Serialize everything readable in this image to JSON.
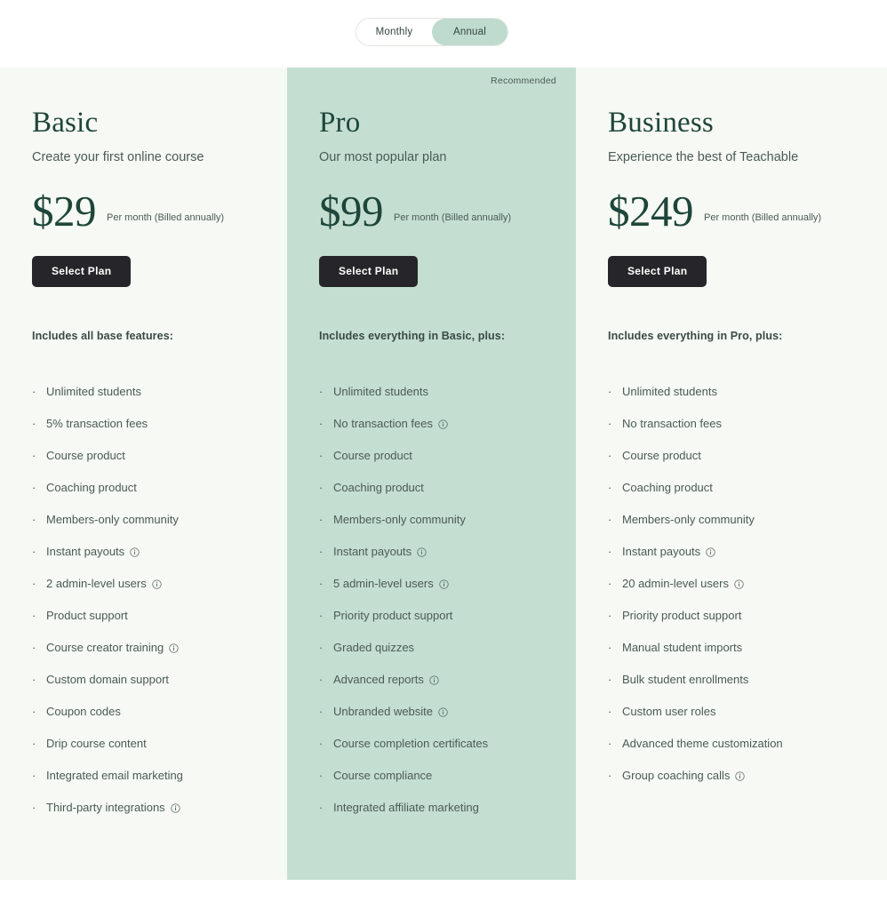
{
  "billing_toggle": {
    "name": "billing-period-toggle",
    "options": [
      {
        "label": "Monthly",
        "selected": false
      },
      {
        "label": "Annual",
        "selected": true
      }
    ]
  },
  "colors": {
    "page_background": "#ffffff",
    "card_background": "#f7f9f4",
    "highlight_background": "#c4dfd2",
    "heading_green": "#1e463a",
    "body_text": "#4a5b54",
    "button_background": "#26262a",
    "button_text": "#ffffff"
  },
  "plans": [
    {
      "name": "Basic",
      "tagline": "Create your first online course",
      "price": "$29",
      "price_note": "Per month (Billed annually)",
      "cta_label": "Select Plan",
      "recommended_label": "",
      "is_recommended": false,
      "features_title": "Includes all base features:",
      "features": [
        {
          "label": "Unlimited students",
          "info": false
        },
        {
          "label": "5% transaction fees",
          "info": false
        },
        {
          "label": "Course product",
          "info": false
        },
        {
          "label": "Coaching product",
          "info": false
        },
        {
          "label": "Members-only community",
          "info": false
        },
        {
          "label": "Instant payouts",
          "info": true
        },
        {
          "label": "2 admin-level users",
          "info": true
        },
        {
          "label": "Product support",
          "info": false
        },
        {
          "label": "Course creator training",
          "info": true
        },
        {
          "label": "Custom domain support",
          "info": false
        },
        {
          "label": "Coupon codes",
          "info": false
        },
        {
          "label": "Drip course content",
          "info": false
        },
        {
          "label": "Integrated email marketing",
          "info": false
        },
        {
          "label": "Third-party integrations",
          "info": true
        }
      ]
    },
    {
      "name": "Pro",
      "tagline": "Our most popular plan",
      "price": "$99",
      "price_note": "Per month (Billed annually)",
      "cta_label": "Select Plan",
      "recommended_label": "Recommended",
      "is_recommended": true,
      "features_title": "Includes everything in Basic, plus:",
      "features": [
        {
          "label": "Unlimited students",
          "info": false
        },
        {
          "label": "No transaction fees",
          "info": true
        },
        {
          "label": "Course product",
          "info": false
        },
        {
          "label": "Coaching product",
          "info": false
        },
        {
          "label": "Members-only community",
          "info": false
        },
        {
          "label": "Instant payouts",
          "info": true
        },
        {
          "label": "5 admin-level users",
          "info": true
        },
        {
          "label": "Priority product support",
          "info": false
        },
        {
          "label": "Graded quizzes",
          "info": false
        },
        {
          "label": "Advanced reports",
          "info": true
        },
        {
          "label": "Unbranded website",
          "info": true
        },
        {
          "label": "Course completion certificates",
          "info": false
        },
        {
          "label": "Course compliance",
          "info": false
        },
        {
          "label": "Integrated affiliate marketing",
          "info": false
        }
      ]
    },
    {
      "name": "Business",
      "tagline": "Experience the best of Teachable",
      "price": "$249",
      "price_note": "Per month (Billed annually)",
      "cta_label": "Select Plan",
      "recommended_label": "",
      "is_recommended": false,
      "features_title": "Includes everything in Pro, plus:",
      "features": [
        {
          "label": "Unlimited students",
          "info": false
        },
        {
          "label": "No transaction fees",
          "info": false
        },
        {
          "label": "Course product",
          "info": false
        },
        {
          "label": "Coaching product",
          "info": false
        },
        {
          "label": "Members-only community",
          "info": false
        },
        {
          "label": "Instant payouts",
          "info": true
        },
        {
          "label": "20 admin-level users",
          "info": true
        },
        {
          "label": "Priority product support",
          "info": false
        },
        {
          "label": "Manual student imports",
          "info": false
        },
        {
          "label": "Bulk student enrollments",
          "info": false
        },
        {
          "label": "Custom user roles",
          "info": false
        },
        {
          "label": "Advanced theme customization",
          "info": false
        },
        {
          "label": "Group coaching calls",
          "info": true
        }
      ]
    }
  ],
  "icons": {
    "info": "info-circle-icon",
    "bullet": "bullet-dot"
  }
}
